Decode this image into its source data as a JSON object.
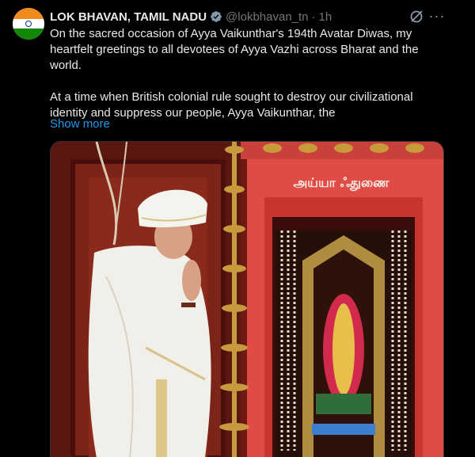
{
  "author": {
    "name": "LOK BHAVAN, TAMIL NADU",
    "handle": "@lokbhavan_tn",
    "separator": "·",
    "time": "1h",
    "avatar": "india-flag-avatar"
  },
  "post": {
    "paragraph1": "On the sacred occasion of Ayya Vaikunthar's 194th Avatar Diwas, my heartfelt greetings to all devotees of Ayya Vazhi across Bharat and the world.",
    "paragraph2": "At a time when British colonial rule sought to destroy our civilizational identity and suppress our people, Ayya Vaikunthar, the",
    "show_more": "Show more"
  },
  "media": {
    "temple_sign": "அய்யா ஃதுணை"
  },
  "icons": {
    "verified": "verified-badge-icon",
    "grok": "grok-icon",
    "more": "more-options-icon"
  },
  "colors": {
    "background": "#000000",
    "text": "#e7e9ea",
    "muted": "#71767b",
    "link": "#1d9bf0"
  }
}
